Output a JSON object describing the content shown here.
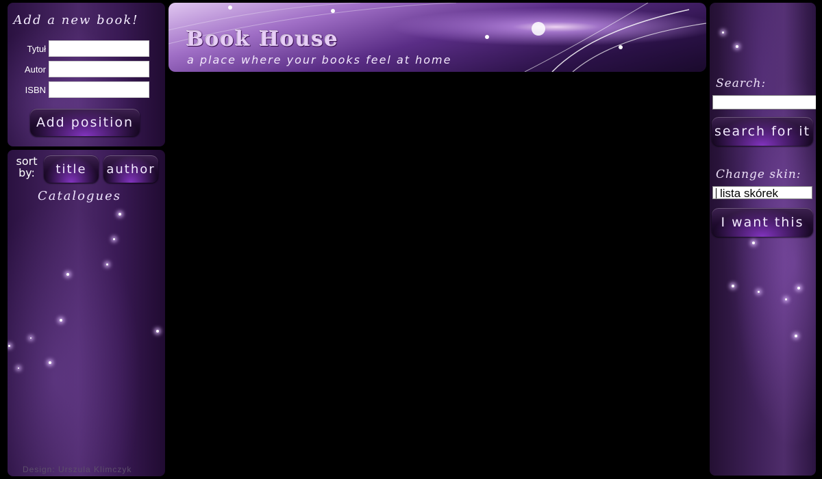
{
  "add_book": {
    "title": "Add a new book!",
    "fields": [
      {
        "label": "Tytuł",
        "value": ""
      },
      {
        "label": "Autor",
        "value": ""
      },
      {
        "label": "ISBN",
        "value": ""
      }
    ],
    "submit_label": "Add position"
  },
  "catalogue": {
    "sort_label": "sort by:",
    "sort_title": "title",
    "sort_author": "author",
    "heading": "Catalogues",
    "credit": "Design: Urszula Klimczyk"
  },
  "header": {
    "title": "Book House",
    "tagline": "a place where your books feel at home"
  },
  "sidebar": {
    "search_label": "Search:",
    "search_value": "",
    "search_button": "search for it",
    "skin_label": "Change skin:",
    "skin_selected": "lista skórek",
    "skin_button": "I want this"
  },
  "colors": {
    "panel_base": "#3f2159",
    "accent": "#9b4fd6",
    "background": "#000000"
  }
}
